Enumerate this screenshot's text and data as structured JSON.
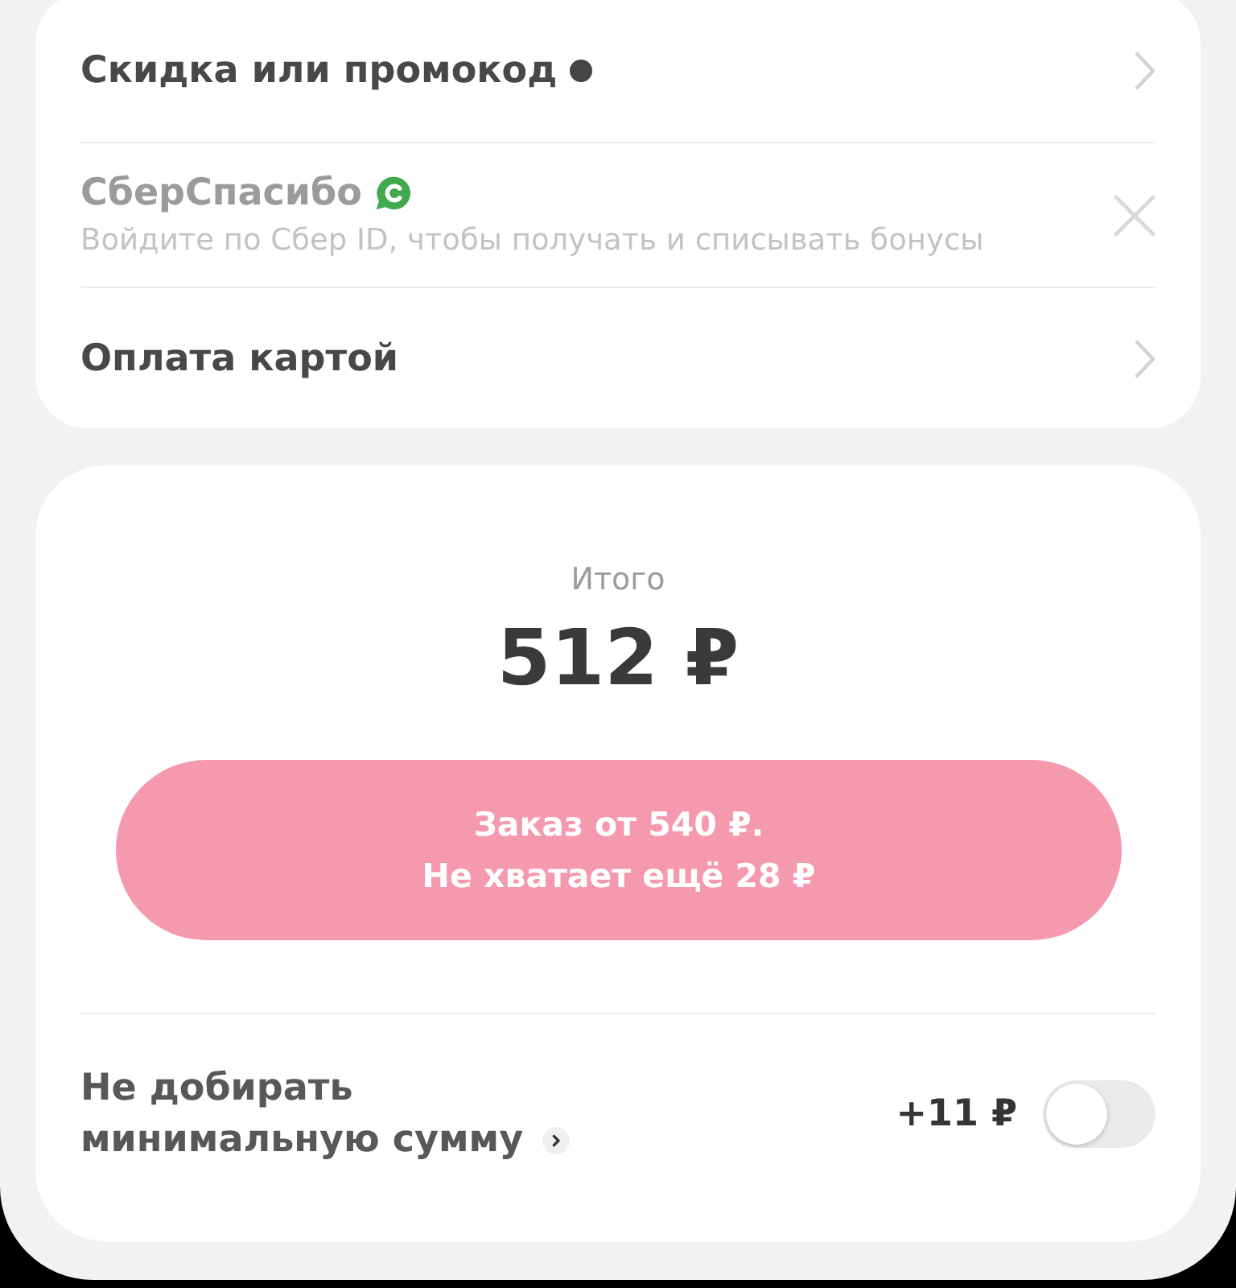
{
  "payment_options": [
    {
      "kind": "link",
      "title": "Скидка или промокод",
      "dot": true,
      "disabled": false
    },
    {
      "kind": "bonus",
      "title": "СберСпасибо",
      "subtitle": "Войдите по Сбер ID, чтобы получать и списывать бонусы",
      "disabled": true
    },
    {
      "kind": "link",
      "title": "Оплата картой",
      "dot": false,
      "disabled": false
    }
  ],
  "summary": {
    "label": "Итого",
    "total": "512 ₽"
  },
  "checkout_button": {
    "lines": [
      "Заказ от 540 ₽.",
      "Не хватает ещё 28 ₽"
    ],
    "disabled": true
  },
  "min_sum_option": {
    "label": "Не добирать минимальную сумму",
    "price": "+11 ₽",
    "on": false
  }
}
